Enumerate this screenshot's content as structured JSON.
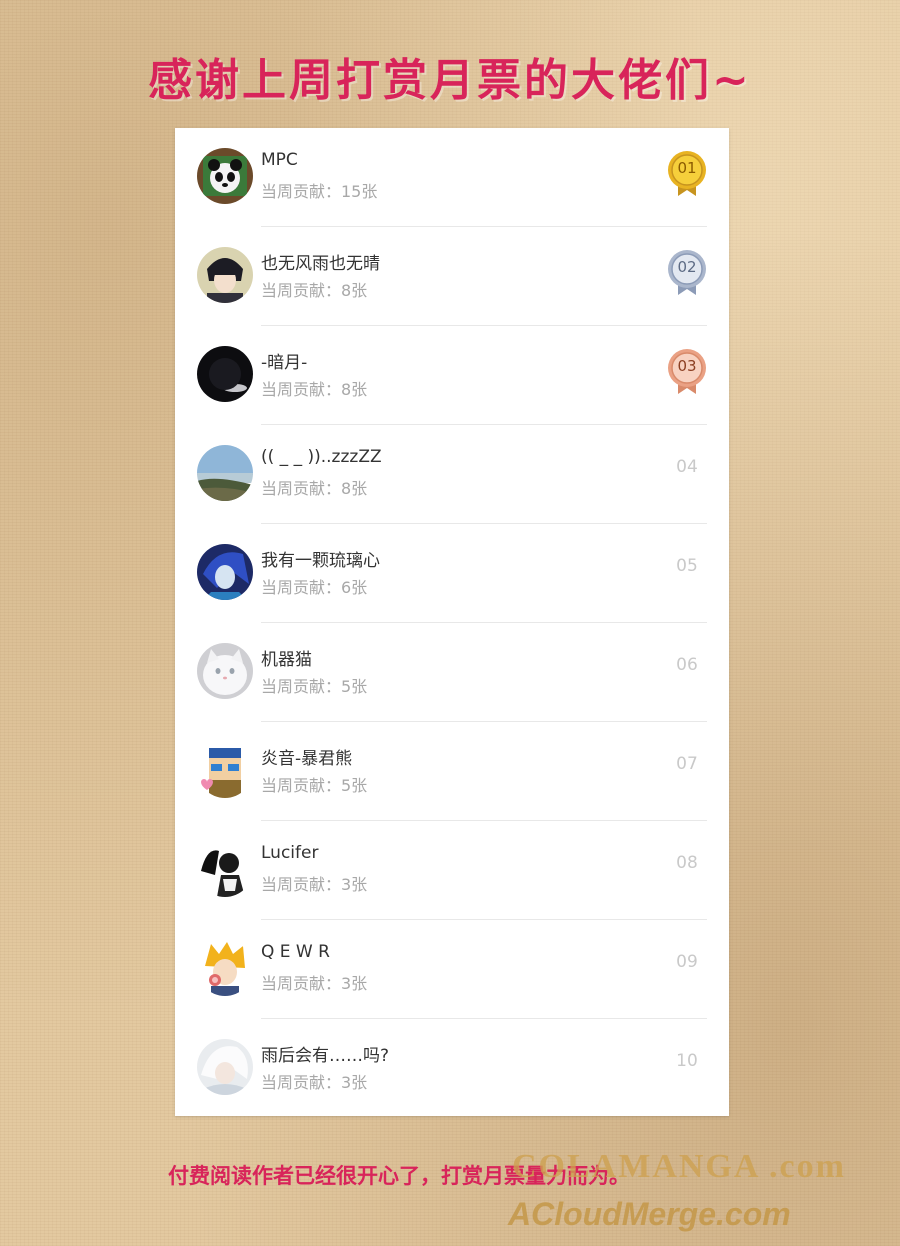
{
  "page": {
    "title": "感谢上周打赏月票的大佬们~",
    "footer_text": "付费阅读作者已经很开心了，打赏月票量力而为。",
    "watermark_line1": "COLAMANGA .com",
    "watermark_line2": "ACloudMerge.com",
    "accent_color": "#d8245a"
  },
  "leaderboard": {
    "contribution_prefix": "当周贡献：",
    "entries": [
      {
        "rank": "01",
        "name": "MPC",
        "contribution": "当周贡献：15张",
        "medal": "gold",
        "avatar_icon": "panda-avatar-icon"
      },
      {
        "rank": "02",
        "name": "也无风雨也无晴",
        "contribution": "当周贡献：8张",
        "medal": "silver",
        "avatar_icon": "anime-boy-avatar-icon"
      },
      {
        "rank": "03",
        "name": "-暗月-",
        "contribution": "当周贡献：8张",
        "medal": "bronze",
        "avatar_icon": "dark-moon-avatar-icon"
      },
      {
        "rank": "04",
        "name": "(( _ _ ))..zzzZZ",
        "contribution": "当周贡献：8张",
        "medal": "none",
        "avatar_icon": "landscape-avatar-icon"
      },
      {
        "rank": "05",
        "name": "我有一颗琉璃心",
        "contribution": "当周贡献：6张",
        "medal": "none",
        "avatar_icon": "blue-hair-avatar-icon"
      },
      {
        "rank": "06",
        "name": "机器猫",
        "contribution": "当周贡献：5张",
        "medal": "none",
        "avatar_icon": "white-cat-avatar-icon"
      },
      {
        "rank": "07",
        "name": "炎音-暴君熊",
        "contribution": "当周贡献：5张",
        "medal": "none",
        "avatar_icon": "pixel-character-avatar-icon"
      },
      {
        "rank": "08",
        "name": "Lucifer",
        "contribution": "当周贡献：3张",
        "medal": "none",
        "avatar_icon": "black-white-sketch-avatar-icon"
      },
      {
        "rank": "09",
        "name": "Q E W R",
        "contribution": "当周贡献：3张",
        "medal": "none",
        "avatar_icon": "blonde-anime-avatar-icon"
      },
      {
        "rank": "10",
        "name": "雨后会有……吗?",
        "contribution": "当周贡献：3张",
        "medal": "none",
        "avatar_icon": "white-hair-avatar-icon"
      }
    ]
  }
}
